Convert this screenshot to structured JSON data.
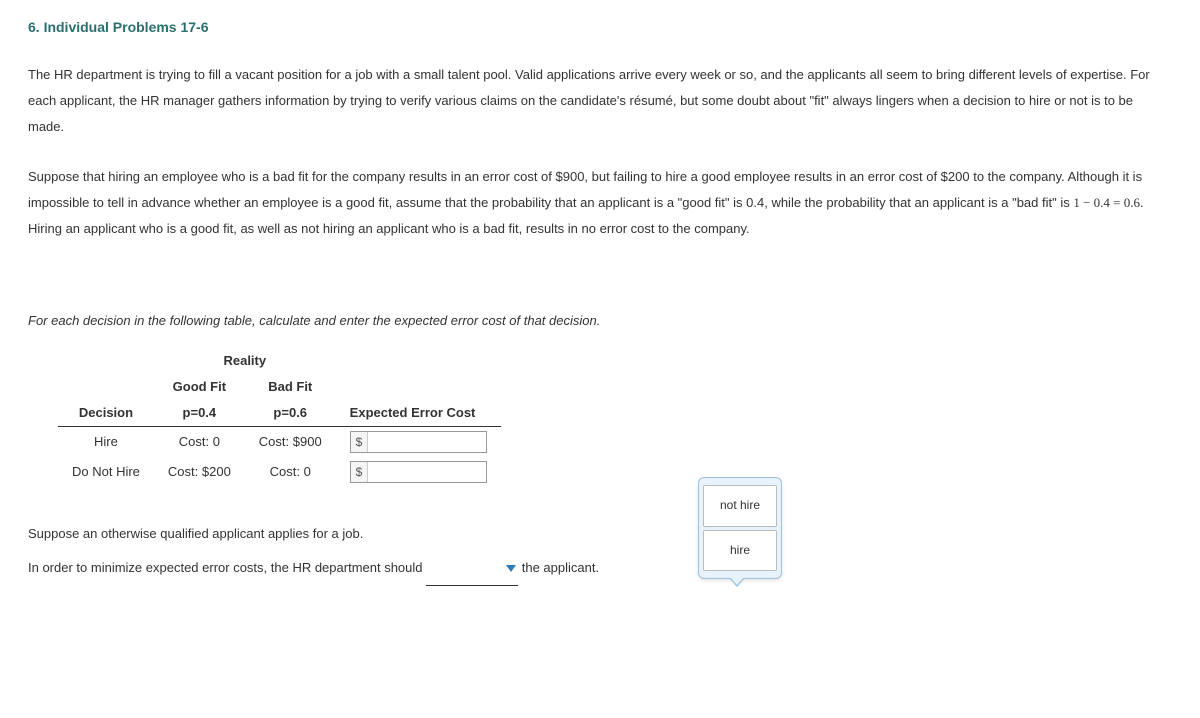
{
  "title": "6. Individual Problems 17-6",
  "para1": "The HR department is trying to fill a vacant position for a job with a small talent pool. Valid applications arrive every week or so, and the applicants all seem to bring different levels of expertise. For each applicant, the HR manager gathers information by trying to verify various claims on the candidate's résumé, but some doubt about \"fit\" always lingers when a decision to hire or not is to be made.",
  "para2_a": "Suppose that hiring an employee who is a bad fit for the company results in an error cost of $900, but failing to hire a good employee results in an error cost of $200 to the company. Although it is impossible to tell in advance whether an employee is a good fit, assume that the probability that an applicant is a \"good fit\" is 0.4, while the probability that an applicant is a \"bad fit\" is ",
  "para2_math": "1 − 0.4 = 0.6",
  "para2_b": ". Hiring an applicant who is a good fit, as well as not hiring an applicant who is a bad fit, results in no error cost to the company.",
  "instruction": "For each decision in the following table, calculate and enter the expected error cost of that decision.",
  "table": {
    "reality": "Reality",
    "good_fit": "Good Fit",
    "bad_fit": "Bad Fit",
    "decision": "Decision",
    "p_good": "p=0.4",
    "p_bad": "p=0.6",
    "expected": "Expected Error Cost",
    "rows": [
      {
        "label": "Hire",
        "good": "Cost: 0",
        "bad": "Cost: $900"
      },
      {
        "label": "Do Not Hire",
        "good": "Cost: $200",
        "bad": "Cost: 0"
      }
    ],
    "currency": "$"
  },
  "q2_line1": "Suppose an otherwise qualified applicant applies for a job.",
  "q2_line2_a": "In order to minimize expected error costs, the HR department should ",
  "q2_line2_b": " the applicant.",
  "dropdown": {
    "options": [
      "not hire",
      "hire"
    ]
  }
}
